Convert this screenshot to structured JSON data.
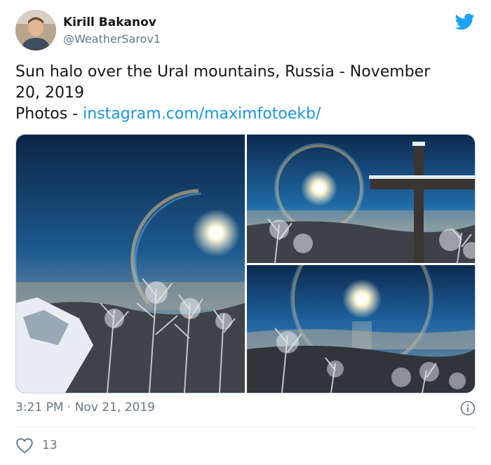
{
  "author": {
    "name": "Kirill Bakanov",
    "handle": "@WeatherSarov1"
  },
  "tweet": {
    "text_line1": "Sun halo over the Ural mountains, Russia - November",
    "text_line2": "20, 2019",
    "photos_prefix": "Photos - ",
    "link_text": "instagram.com/maximfotoekb/",
    "timestamp": "3:21 PM · Nov 21, 2019",
    "like_count": "13"
  },
  "colors": {
    "brand_blue": "#1da1f2",
    "link": "#1b95e0",
    "muted": "#657786"
  },
  "icons": {
    "brand": "twitter-bird-icon",
    "info": "info-icon",
    "like": "heart-icon"
  }
}
